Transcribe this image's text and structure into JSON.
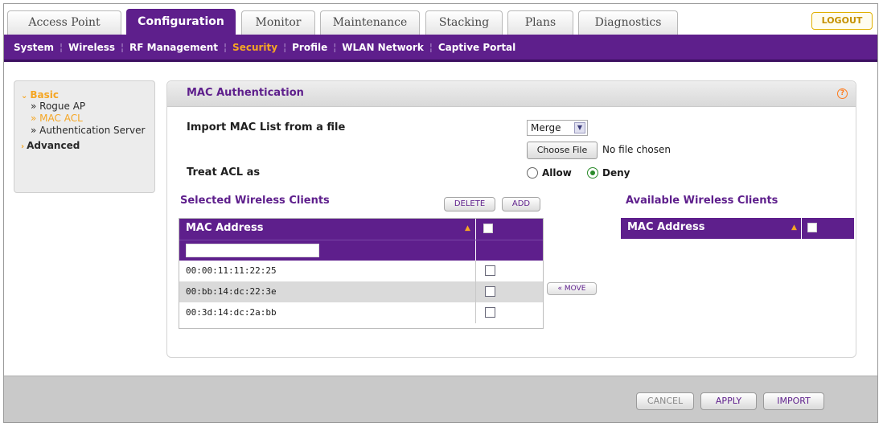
{
  "tabs": [
    {
      "label": "Access Point",
      "active": false
    },
    {
      "label": "Configuration",
      "active": true
    },
    {
      "label": "Monitor",
      "active": false
    },
    {
      "label": "Maintenance",
      "active": false
    },
    {
      "label": "Stacking",
      "active": false
    },
    {
      "label": "Plans",
      "active": false
    },
    {
      "label": "Diagnostics",
      "active": false
    }
  ],
  "logout_label": "LOGOUT",
  "subnav": [
    {
      "label": "System",
      "active": false
    },
    {
      "label": "Wireless",
      "active": false
    },
    {
      "label": "RF Management",
      "active": false
    },
    {
      "label": "Security",
      "active": true
    },
    {
      "label": "Profile",
      "active": false
    },
    {
      "label": "WLAN Network",
      "active": false
    },
    {
      "label": "Captive Portal",
      "active": false
    }
  ],
  "leftnav": {
    "basic_label": "Basic",
    "items": [
      "» Rogue AP",
      "» MAC ACL",
      "» Authentication Server"
    ],
    "active_index": 1,
    "advanced_label": "Advanced"
  },
  "panel": {
    "title": "MAC Authentication",
    "import_label": "Import MAC List from a file",
    "import_mode": "Merge",
    "choose_file_label": "Choose File",
    "no_file_text": "No file chosen",
    "treat_acl_label": "Treat ACL as",
    "allow_label": "Allow",
    "deny_label": "Deny",
    "treat_acl_value": "Deny",
    "selected_title": "Selected Wireless Clients",
    "delete_label": "DELETE",
    "add_label": "ADD",
    "available_title": "Available Wireless Clients",
    "mac_col_header": "MAC Address",
    "filter_value": "",
    "selected_rows": [
      "00:00:11:11:22:25",
      "00:bb:14:dc:22:3e",
      "00:3d:14:dc:2a:bb"
    ],
    "move_label": "« MOVE"
  },
  "footer": {
    "cancel_label": "CANCEL",
    "apply_label": "APPLY",
    "import_label": "IMPORT"
  },
  "colors": {
    "brand_purple": "#5e1f8c",
    "accent_orange": "#f5a623"
  }
}
